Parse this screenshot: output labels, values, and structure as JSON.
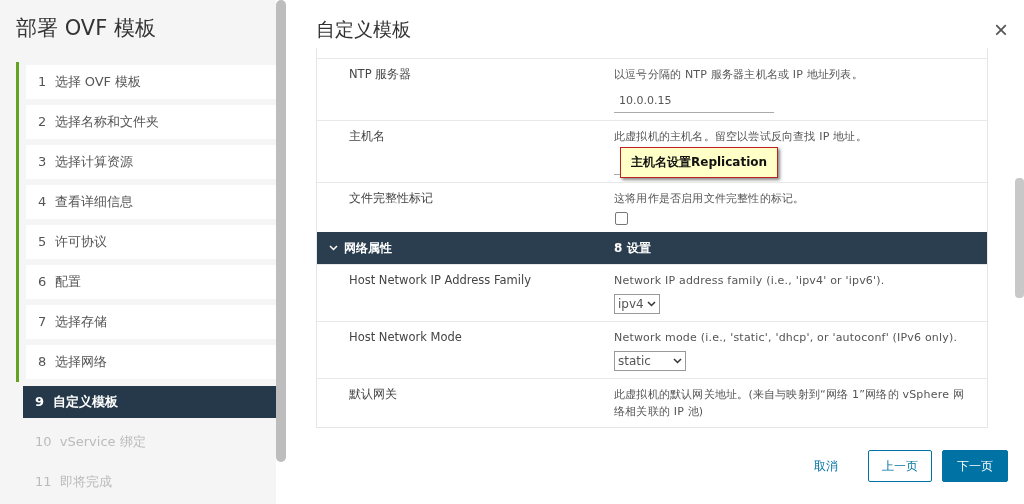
{
  "sidebar": {
    "title": "部署 OVF 模板",
    "steps": [
      {
        "number": "1",
        "label": "选择 OVF 模板",
        "completed": true,
        "selected": false,
        "disabled": false
      },
      {
        "number": "2",
        "label": "选择名称和文件夹",
        "completed": true,
        "selected": false,
        "disabled": false
      },
      {
        "number": "3",
        "label": "选择计算资源",
        "completed": true,
        "selected": false,
        "disabled": false
      },
      {
        "number": "4",
        "label": "查看详细信息",
        "completed": true,
        "selected": false,
        "disabled": false
      },
      {
        "number": "5",
        "label": "许可协议",
        "completed": true,
        "selected": false,
        "disabled": false
      },
      {
        "number": "6",
        "label": "配置",
        "completed": true,
        "selected": false,
        "disabled": false
      },
      {
        "number": "7",
        "label": "选择存储",
        "completed": true,
        "selected": false,
        "disabled": false
      },
      {
        "number": "8",
        "label": "选择网络",
        "completed": true,
        "selected": false,
        "disabled": false
      },
      {
        "number": "9",
        "label": "自定义模板",
        "completed": false,
        "selected": true,
        "disabled": false
      },
      {
        "number": "10",
        "label": "vService 绑定",
        "completed": false,
        "selected": false,
        "disabled": true
      },
      {
        "number": "11",
        "label": "即将完成",
        "completed": false,
        "selected": false,
        "disabled": true
      }
    ]
  },
  "main": {
    "title": "自定义模板",
    "close": "×",
    "rows": [
      {
        "kind": "input",
        "label": "NTP 服务器",
        "description": "以逗号分隔的 NTP 服务器主机名或 IP 地址列表。",
        "value": "10.0.0.15"
      },
      {
        "kind": "input",
        "label": "主机名",
        "description": "此虚拟机的主机名。留空以尝试反向查找 IP 地址。",
        "callout": "主机名设置Replication"
      },
      {
        "kind": "checkbox",
        "label": "文件完整性标记",
        "description": "这将用作是否启用文件完整性的标记。",
        "checked": false
      },
      {
        "kind": "group",
        "label": "网络属性",
        "count": "8 设置",
        "expanded": true
      },
      {
        "kind": "select",
        "label": "Host Network IP Address Family",
        "description": "Network IP address family (i.e., 'ipv4' or 'ipv6').",
        "value": "ipv4"
      },
      {
        "kind": "select",
        "label": "Host Network Mode",
        "description": "Network mode (i.e., 'static', 'dhcp', or 'autoconf' (IPv6 only).",
        "value": "static",
        "wide": true
      },
      {
        "kind": "text",
        "label": "默认网关",
        "description": "此虚拟机的默认网关地址。(来自与映射到“网络 1”网络的 vSphere 网络相关联的 IP 池)"
      }
    ]
  },
  "buttons": {
    "cancel": "取消",
    "back": "上一页",
    "next": "下一页"
  }
}
